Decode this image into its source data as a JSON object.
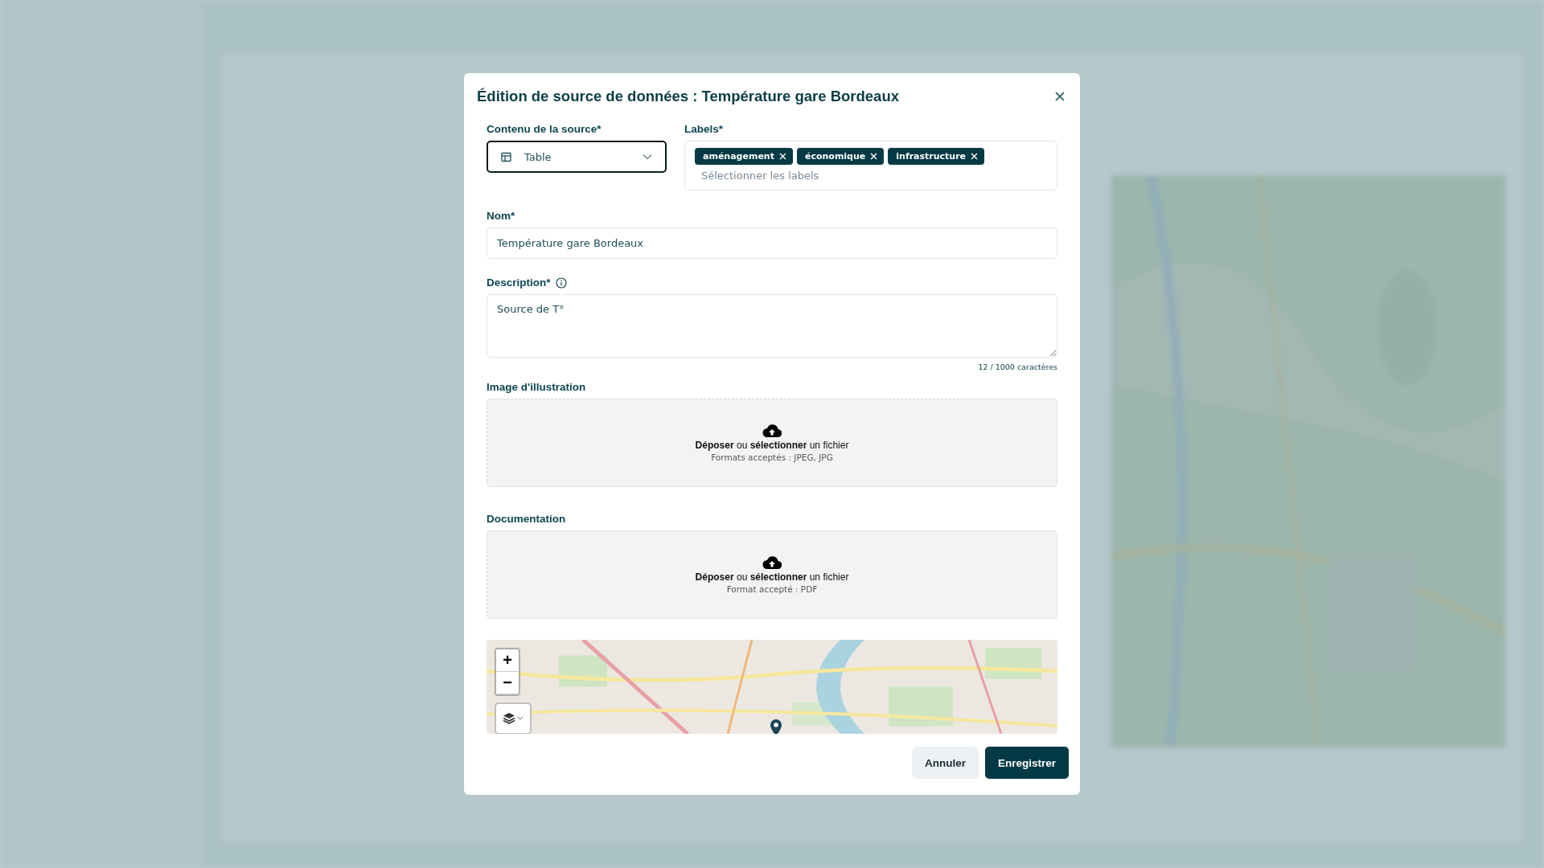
{
  "dialog": {
    "title": "Édition de source de données : Température gare Bordeaux"
  },
  "source_content": {
    "label": "Contenu de la source*",
    "value": "Table",
    "focused": true
  },
  "labels": {
    "label": "Labels*",
    "tags": [
      "aménagement",
      "économique",
      "infrastructure"
    ],
    "placeholder": "Sélectionner les labels"
  },
  "name": {
    "label": "Nom*",
    "value": "Température gare Bordeaux"
  },
  "description": {
    "label": "Description*",
    "value": "Source de T°",
    "counter": "12 / 1000 caractères"
  },
  "uploads": [
    {
      "label": "Image d'illustration",
      "action": "**Déposer** ou **sélectionner** un fichier",
      "formats": "Formats acceptés : JPEG, JPG"
    },
    {
      "label": "Documentation",
      "action": "**Déposer** ou **sélectionner** un fichier",
      "formats": "Format accepté : PDF"
    }
  ],
  "map": {
    "kind": "picture",
    "zoom_in": "+",
    "zoom_out": "−"
  },
  "buttons": [
    {
      "label": "Annuler",
      "kind": "secondary"
    },
    {
      "label": "Enregistrer",
      "kind": "primary"
    }
  ]
}
